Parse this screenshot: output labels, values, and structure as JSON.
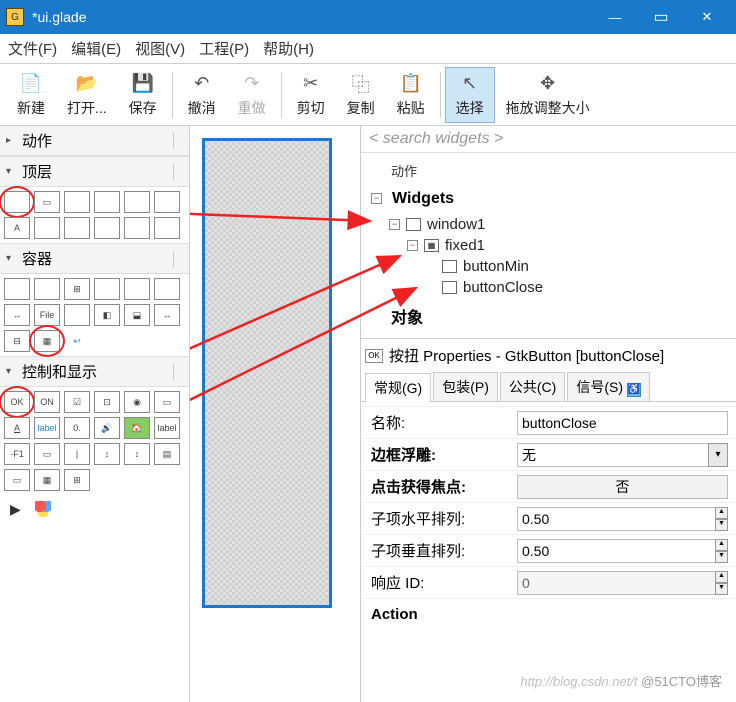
{
  "window": {
    "title": "*ui.glade"
  },
  "menu": {
    "file": "文件(F)",
    "edit": "编辑(E)",
    "view": "视图(V)",
    "project": "工程(P)",
    "help": "帮助(H)"
  },
  "toolbar": {
    "new": "新建",
    "open": "打开...",
    "save": "保存",
    "undo": "撤消",
    "redo": "重做",
    "cut": "剪切",
    "copy": "复制",
    "paste": "粘贴",
    "select": "选择",
    "drag_resize": "拖放调整大小"
  },
  "palette": {
    "sec_actions": "动作",
    "sec_toplevel": "顶层",
    "sec_containers": "容器",
    "sec_control_display": "控制和显示"
  },
  "search": {
    "placeholder": "< search widgets >"
  },
  "tree": {
    "widgets_title": "Widgets",
    "cutoff_top": "动作",
    "items": [
      {
        "name": "window1",
        "indent": 0,
        "exp": "-"
      },
      {
        "name": "fixed1",
        "indent": 1,
        "exp": "-"
      },
      {
        "name": "buttonMin",
        "indent": 2,
        "exp": ""
      },
      {
        "name": "buttonClose",
        "indent": 2,
        "exp": ""
      }
    ],
    "objects_title": "对象"
  },
  "props": {
    "header_badge": "OK",
    "header_label": "按扭 Properties - GtkButton [buttonClose]",
    "tabs": {
      "general": "常规(G)",
      "packing": "包装(P)",
      "common": "公共(C)",
      "signals": "信号(S)"
    },
    "rows": {
      "name_lbl": "名称:",
      "name_val": "buttonClose",
      "relief_lbl": "边框浮雕:",
      "relief_val": "无",
      "focus_lbl": "点击获得焦点:",
      "focus_val": "否",
      "halign_lbl": "子项水平排列:",
      "halign_val": "0.50",
      "valign_lbl": "子项垂直排列:",
      "valign_val": "0.50",
      "respid_lbl": "响应 ID:",
      "respid_val": "0",
      "action_hdr": "Action"
    }
  },
  "watermark": {
    "url": "http://blog.csdn.net/t",
    "brand": "@51CTO博客"
  }
}
